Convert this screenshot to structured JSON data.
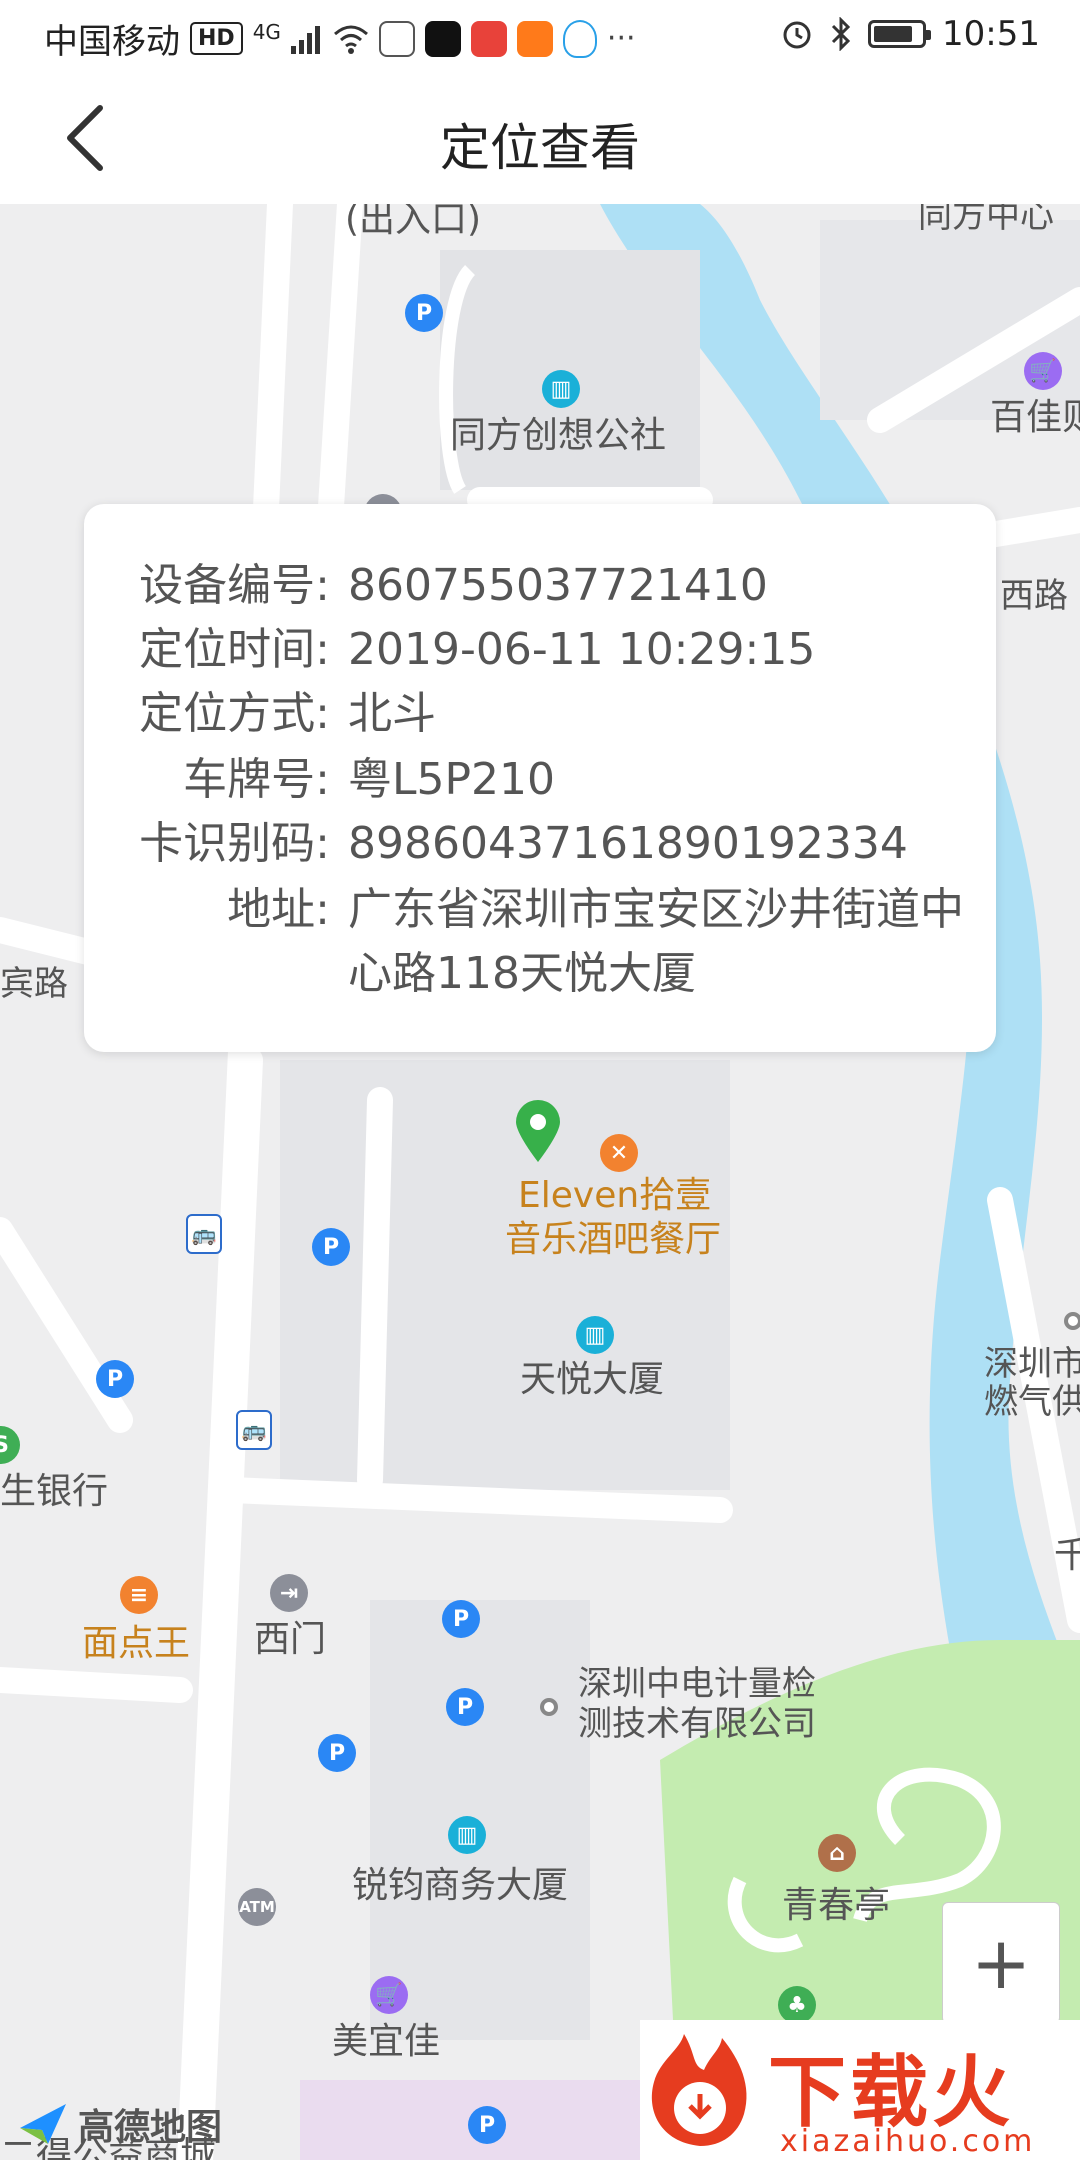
{
  "status_bar": {
    "carrier": "中国移动",
    "hd_badge": "HD",
    "network": "4G",
    "time": "10:51"
  },
  "header": {
    "title": "定位查看"
  },
  "info_card": {
    "rows": [
      {
        "label": "设备编号:",
        "value": "860755037721410"
      },
      {
        "label": "定位时间:",
        "value": "2019-06-11 10:29:15"
      },
      {
        "label": "定位方式:",
        "value": "北斗"
      },
      {
        "label": "车牌号:",
        "value": "粤L5P210"
      },
      {
        "label": "卡识别码:",
        "value": "89860437161890192334"
      },
      {
        "label": "地址:",
        "value": "广东省深圳市宝安区沙井街道中心路118天悦大厦"
      }
    ]
  },
  "map": {
    "labels": {
      "entrance": "(出入口)",
      "tongfang_center": "同方中心",
      "tongfang_commune": "同方创想公社",
      "baijia": "百佳则",
      "road_east": "西路",
      "road_west": "宾路",
      "eleven_line1": "Eleven拾壹",
      "eleven_line2": "音乐酒吧餐厅",
      "tianyue": "天悦大厦",
      "gas_line1": "深圳市",
      "gas_line2": "燃气供",
      "bank": "生银行",
      "qian": "千",
      "mianidan": "面点王",
      "ximen": "西门",
      "zhongdian_line1": "深圳中电计量检",
      "zhongdian_line2": "测技术有限公司",
      "qingchun": "青春亭",
      "ruijun": "锐钧商务大厦",
      "meiyijia": "美宜佳",
      "gongyi": "二得公益商城"
    },
    "zoom_in": "+",
    "poi_icons": {
      "parking": "P",
      "atm": "ATM"
    }
  },
  "watermarks": {
    "amap": "高德地图",
    "site_name": "下载火",
    "site_url": "xiazaihuo.com"
  },
  "colors": {
    "river": "#aee0f5",
    "park": "#c4ecb0",
    "marker": "#37b04a",
    "parking": "#2a87f5",
    "brand_red": "#e63c1f"
  }
}
